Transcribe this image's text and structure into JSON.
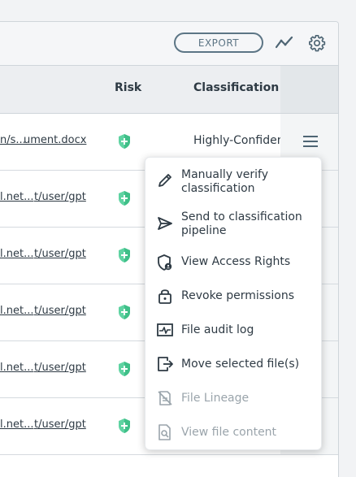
{
  "toolbar": {
    "export_label": "EXPORT",
    "icons": [
      "trend-chart-icon",
      "gear-icon"
    ]
  },
  "table": {
    "columns": {
      "risk": "Risk",
      "classification": "Classification"
    },
    "rows": [
      {
        "path": "n/s...",
        "file": "ument.docx",
        "risk_icon": "shield-icon",
        "classification": "Highly-Confiden"
      },
      {
        "path": "l.net...",
        "file": "t/user/gpt",
        "risk_icon": "shield-icon",
        "classification": ""
      },
      {
        "path": "l.net...",
        "file": "t/user/gpt",
        "risk_icon": "shield-icon",
        "classification": ""
      },
      {
        "path": "l.net...",
        "file": "t/user/gpt",
        "risk_icon": "shield-icon",
        "classification": ""
      },
      {
        "path": "l.net...",
        "file": "t/user/gpt",
        "risk_icon": "shield-icon",
        "classification": ""
      },
      {
        "path": "l.net...",
        "file": "t/user/gpt",
        "risk_icon": "shield-icon",
        "classification": ""
      }
    ]
  },
  "menu": {
    "items": [
      {
        "label": "Manually verify classification",
        "icon": "pencil-icon",
        "enabled": true
      },
      {
        "label": "Send to classification pipeline",
        "icon": "send-icon",
        "enabled": true
      },
      {
        "label": "View Access Rights",
        "icon": "shield-user-icon",
        "enabled": true
      },
      {
        "label": "Revoke permissions",
        "icon": "lock-icon",
        "enabled": true
      },
      {
        "label": "File audit log",
        "icon": "audit-log-icon",
        "enabled": true
      },
      {
        "label": "Move selected file(s)",
        "icon": "move-file-icon",
        "enabled": true
      },
      {
        "label": "File Lineage",
        "icon": "lineage-icon",
        "enabled": false
      },
      {
        "label": "View file content",
        "icon": "file-search-icon",
        "enabled": false
      }
    ]
  },
  "colors": {
    "accent": "#5c7585",
    "risk_low": "#5fd3a2",
    "text": "#2e3a44",
    "disabled_text": "#9aa4ab"
  }
}
